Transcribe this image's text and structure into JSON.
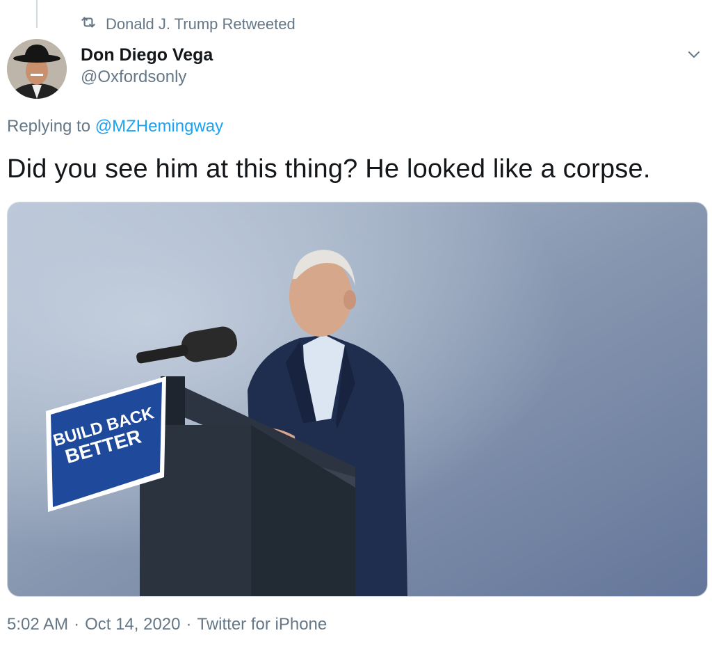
{
  "retweet_banner": {
    "icon": "retweet-icon",
    "text": "Donald J. Trump Retweeted"
  },
  "author": {
    "display_name": "Don Diego Vega",
    "handle": "@Oxfordsonly",
    "avatar_icon": "avatar"
  },
  "reply_context": {
    "prefix": "Replying to",
    "mention": "@MZHemingway"
  },
  "tweet": {
    "text": "Did you see him at this thing? He looked like a corpse."
  },
  "media": {
    "sign_line1": "BUILD BACK",
    "sign_line2": "BETTER"
  },
  "meta": {
    "time": "5:02 AM",
    "sep1": "·",
    "date": "Oct 14, 2020",
    "sep2": "·",
    "source": "Twitter for iPhone"
  },
  "colors": {
    "link": "#1da1f2",
    "secondary_text": "#657786",
    "primary_text": "#14171a"
  }
}
